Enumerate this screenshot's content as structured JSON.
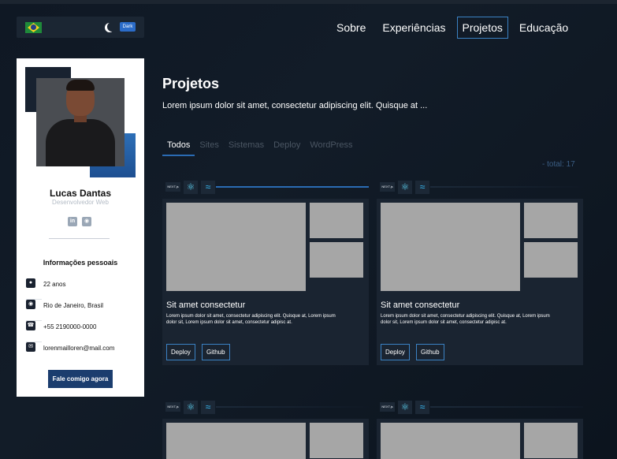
{
  "theme": {
    "accent": "#3b82c4",
    "card_bg": "#1a2431",
    "page_bg": "#0f1824"
  },
  "header": {
    "language_flag": "brazil-flag-icon",
    "theme_icon": "moon-icon",
    "theme_label": "Dark",
    "nav": [
      {
        "label": "Sobre",
        "active": false
      },
      {
        "label": "Experiências",
        "active": false
      },
      {
        "label": "Projetos",
        "active": true
      },
      {
        "label": "Educação",
        "active": false
      }
    ]
  },
  "profile": {
    "name": "Lucas Dantas",
    "role": "Desenvolvedor Web",
    "socials": [
      "linkedin-icon",
      "github-icon"
    ],
    "info_title": "Informações pessoais",
    "info": [
      {
        "icon": "person-icon",
        "text": "22 anos"
      },
      {
        "icon": "location-icon",
        "text": "Rio de Janeiro, Brasil"
      },
      {
        "icon": "phone-icon",
        "text": "+55 2190000-0000"
      },
      {
        "icon": "mail-icon",
        "text": "lorenmailloren@mail.com"
      }
    ],
    "contact_button": "Fale comigo agora"
  },
  "projects": {
    "title": "Projetos",
    "description": "Lorem ipsum dolor sit amet, consectetur adipiscing elit. Quisque at ...",
    "filters": [
      {
        "label": "Todos",
        "active": true
      },
      {
        "label": "Sites",
        "active": false
      },
      {
        "label": "Sistemas",
        "active": false
      },
      {
        "label": "Deploy",
        "active": false
      },
      {
        "label": "WordPress",
        "active": false
      }
    ],
    "total": "- total: 17",
    "cards": [
      {
        "tech": [
          "NEXT.js",
          "react-icon",
          "tailwind-icon"
        ],
        "title": "Sit amet consectetur",
        "description": "Lorem ipsum dolor sit amet, consectetur adipiscing elit. Quisque at, Lorem ipsum dolor sit, Lorem ipsum dolor sit amet, consectetur adipisc at.",
        "deploy": "Deploy",
        "github": "Github"
      },
      {
        "tech": [
          "NEXT.js",
          "react-icon",
          "tailwind-icon"
        ],
        "title": "Sit amet consectetur",
        "description": "Lorem ipsum dolor sit amet, consectetur adipiscing elit. Quisque at, Lorem ipsum dolor sit, Lorem ipsum dolor sit amet, consectetur adipisc at.",
        "deploy": "Deploy",
        "github": "Github"
      },
      {
        "tech": [
          "NEXT.js",
          "react-icon",
          "tailwind-icon"
        ]
      },
      {
        "tech": [
          "NEXT.js",
          "react-icon",
          "tailwind-icon"
        ]
      }
    ]
  }
}
